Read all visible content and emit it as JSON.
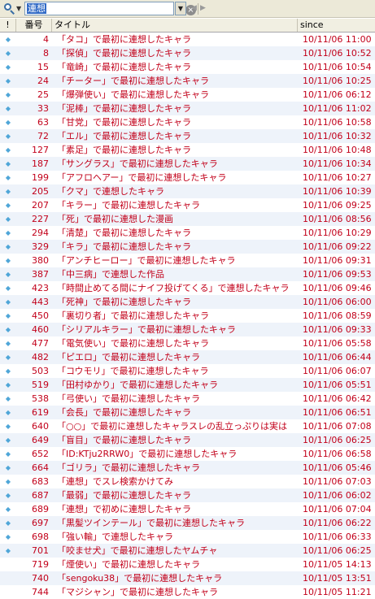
{
  "search": {
    "query": "連想"
  },
  "icons": {
    "search": "search-icon",
    "clear": "clear-icon",
    "dropdown": "dropdown-icon",
    "back": "back-icon",
    "forward": "forward-icon"
  },
  "columns": {
    "mark": "!",
    "number": "番号",
    "title": "タイトル",
    "since": "since"
  },
  "colors": {
    "text": "#c2001a",
    "marker": "#4fa6d8",
    "selection": "#316ac5"
  },
  "threads": [
    {
      "number": "4",
      "title": "「タコ」で最初に連想したキャラ",
      "since": "10/11/06 11:00",
      "marked": true
    },
    {
      "number": "8",
      "title": "「探偵」で最初に連想したキャラ",
      "since": "10/11/06 10:52",
      "marked": true
    },
    {
      "number": "15",
      "title": "「竜崎」で最初に連想したキャラ",
      "since": "10/11/06 10:54",
      "marked": true
    },
    {
      "number": "24",
      "title": "「チーター」で最初に連想したキャラ",
      "since": "10/11/06 10:25",
      "marked": true
    },
    {
      "number": "25",
      "title": "「爆弾使い」で最初に連想したキャラ",
      "since": "10/11/06 06:12",
      "marked": true
    },
    {
      "number": "33",
      "title": "「泥棒」で最初に連想したキャラ",
      "since": "10/11/06 11:02",
      "marked": true
    },
    {
      "number": "63",
      "title": "「甘党」で最初に連想したキャラ",
      "since": "10/11/06 10:58",
      "marked": true
    },
    {
      "number": "72",
      "title": "「エル」で最初に連想したキャラ",
      "since": "10/11/06 10:32",
      "marked": true
    },
    {
      "number": "127",
      "title": "「素足」で最初に連想したキャラ",
      "since": "10/11/06 10:48",
      "marked": true
    },
    {
      "number": "187",
      "title": "「サングラス」で最初に連想したキャラ",
      "since": "10/11/06 10:34",
      "marked": true
    },
    {
      "number": "199",
      "title": "「アフロヘアー」で最初に連想したキャラ",
      "since": "10/11/06 10:27",
      "marked": true
    },
    {
      "number": "205",
      "title": "「クマ」で連想したキャラ",
      "since": "10/11/06 10:39",
      "marked": true
    },
    {
      "number": "207",
      "title": "「キラー」で最初に連想したキャラ",
      "since": "10/11/06 09:25",
      "marked": true
    },
    {
      "number": "227",
      "title": "「死」で最初に連想した漫画",
      "since": "10/11/06 08:56",
      "marked": true
    },
    {
      "number": "294",
      "title": "「清楚」で最初に連想したキャラ",
      "since": "10/11/06 10:29",
      "marked": true
    },
    {
      "number": "329",
      "title": "「キラ」で最初に連想したキャラ",
      "since": "10/11/06 09:22",
      "marked": true
    },
    {
      "number": "380",
      "title": "「アンチヒーロー」で最初に連想したキャラ",
      "since": "10/11/06 09:31",
      "marked": true
    },
    {
      "number": "387",
      "title": "「中三病」で連想した作品",
      "since": "10/11/06 09:53",
      "marked": true
    },
    {
      "number": "423",
      "title": "「時間止めてる間にナイフ投げてくる」で連想したキャラ",
      "since": "10/11/06 09:46",
      "marked": true
    },
    {
      "number": "443",
      "title": "「死神」で最初に連想したキャラ",
      "since": "10/11/06 06:00",
      "marked": true
    },
    {
      "number": "450",
      "title": "「裏切り者」で最初に連想したキャラ",
      "since": "10/11/06 08:59",
      "marked": true
    },
    {
      "number": "460",
      "title": "「シリアルキラー」で最初に連想したキャラ",
      "since": "10/11/06 09:33",
      "marked": true
    },
    {
      "number": "477",
      "title": "「電気使い」で最初に連想したキャラ",
      "since": "10/11/06 05:58",
      "marked": true
    },
    {
      "number": "482",
      "title": "「ピエロ」で最初に連想したキャラ",
      "since": "10/11/06 06:44",
      "marked": true
    },
    {
      "number": "503",
      "title": "「コウモリ」で最初に連想したキャラ",
      "since": "10/11/06 06:07",
      "marked": true
    },
    {
      "number": "519",
      "title": "「田村ゆかり」で最初に連想したキャラ",
      "since": "10/11/06 05:51",
      "marked": true
    },
    {
      "number": "538",
      "title": "「弓使い」で最初に連想したキャラ",
      "since": "10/11/06 06:42",
      "marked": true
    },
    {
      "number": "619",
      "title": "「会長」で最初に連想したキャラ",
      "since": "10/11/06 06:51",
      "marked": true
    },
    {
      "number": "640",
      "title": "「○○」で最初に連想したキャラスレの乱立っぷりは実は",
      "since": "10/11/06 07:08",
      "marked": true
    },
    {
      "number": "649",
      "title": "「盲目」で最初に連想したキャラ",
      "since": "10/11/06 06:25",
      "marked": true
    },
    {
      "number": "652",
      "title": "「ID:KTju2RRW0」で最初に連想したキャラ",
      "since": "10/11/06 06:58",
      "marked": true
    },
    {
      "number": "664",
      "title": "「ゴリラ」で最初に連想したキャラ",
      "since": "10/11/06 05:46",
      "marked": true
    },
    {
      "number": "683",
      "title": "「連想」でスレ検索かけてみ",
      "since": "10/11/06 07:03",
      "marked": true
    },
    {
      "number": "687",
      "title": "「最弱」で最初に連想したキャラ",
      "since": "10/11/06 06:02",
      "marked": true
    },
    {
      "number": "689",
      "title": "「連想」で初めに連想したキャラ",
      "since": "10/11/06 07:04",
      "marked": true
    },
    {
      "number": "697",
      "title": "「黒髪ツインテール」で最初に連想したキャラ",
      "since": "10/11/06 06:22",
      "marked": true
    },
    {
      "number": "698",
      "title": "「強い輸」で連想したキャラ",
      "since": "10/11/06 06:33",
      "marked": true
    },
    {
      "number": "701",
      "title": "「咬ませ犬」で最初に連想したヤムチャ",
      "since": "10/11/06 06:25",
      "marked": true
    },
    {
      "number": "719",
      "title": "「煙使い」で最初に連想したキャラ",
      "since": "10/11/05 14:13",
      "marked": false
    },
    {
      "number": "740",
      "title": "「sengoku38」で最初に連想したキャラ",
      "since": "10/11/05 13:51",
      "marked": false
    },
    {
      "number": "744",
      "title": "「マジシャン」で最初に連想したキャラ",
      "since": "10/11/05 11:21",
      "marked": false
    }
  ]
}
